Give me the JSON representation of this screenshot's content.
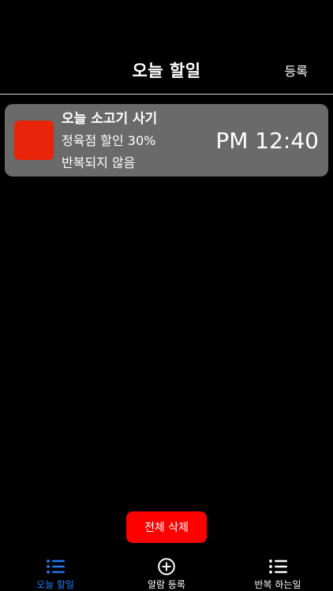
{
  "header": {
    "title": "오늘 할일",
    "register_label": "등록"
  },
  "todos": [
    {
      "title": "오늘 소고기 사기",
      "memo": "정육점 할인 30%",
      "repeat": "반복되지 않음",
      "time": "PM 12:40",
      "color": "#e8250a"
    }
  ],
  "footer": {
    "delete_all_label": "전체 삭제"
  },
  "tab_bar": {
    "active_color": "#1e7bf2",
    "inactive_color": "#ffffff",
    "tabs": [
      {
        "label": "오늘 할일",
        "icon": "list-icon",
        "active": true
      },
      {
        "label": "알람 등록",
        "icon": "plus-circle-icon",
        "active": false
      },
      {
        "label": "반복 하는일",
        "icon": "list-icon",
        "active": false
      }
    ]
  }
}
